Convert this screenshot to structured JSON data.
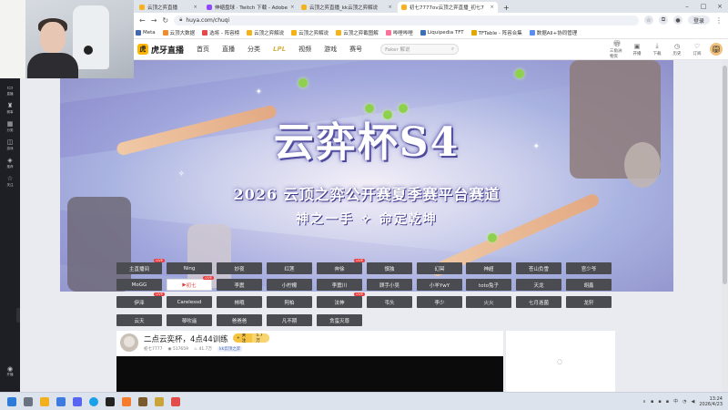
{
  "browser": {
    "tabs": [
      {
        "label": "云顶之弈直播",
        "active": false
      },
      {
        "label": "伸缩盘球 · Twitch 下载 - Adobe",
        "active": false
      },
      {
        "label": "云顶之弈直播_kk云顶之弈解说",
        "active": false
      },
      {
        "label": "初七7777ov云顶之弈直播_初七7",
        "active": true
      }
    ],
    "new_tab": "+",
    "url": "huya.com/chuqi",
    "login_label": "登录",
    "bookmarks": [
      {
        "label": "Meta",
        "color": "#4267b2"
      },
      {
        "label": "云顶大数据",
        "color": "#f28c28"
      },
      {
        "label": "选将 - 阵容榜",
        "color": "#e34a4a"
      },
      {
        "label": "云顶之弈解说",
        "color": "#f6b21b"
      },
      {
        "label": "云顶之弈解说",
        "color": "#f6b21b"
      },
      {
        "label": "云顶之弈截图解",
        "color": "#f6b21b"
      },
      {
        "label": "哔哩哔哩",
        "color": "#fb7299"
      },
      {
        "label": "Liquipedia TFT",
        "color": "#3b6fb6"
      },
      {
        "label": "TFTable - 阵容合集",
        "color": "#e0a800"
      },
      {
        "label": "数据All+协同管理",
        "color": "#5a8dee"
      }
    ]
  },
  "huya": {
    "logo_text": "虎牙直播",
    "nav": [
      "首页",
      "直播",
      "分类",
      "LPL",
      "视频",
      "游戏",
      "赛号"
    ],
    "search_placeholder": "Faker 解说",
    "right_items": [
      {
        "label": "三角洲物资",
        "icon": "gift-icon"
      },
      {
        "label": "开播",
        "icon": "camera-icon"
      },
      {
        "label": "下载",
        "icon": "download-icon"
      },
      {
        "label": "历史",
        "icon": "clock-icon"
      },
      {
        "label": "订阅",
        "icon": "heart-icon"
      }
    ]
  },
  "sidebar": {
    "items": [
      {
        "label": "直播",
        "icon": "tv-icon"
      },
      {
        "label": "赛事",
        "icon": "trophy-icon"
      },
      {
        "label": "分类",
        "icon": "grid-icon"
      },
      {
        "label": "游戏",
        "icon": "gamepad-icon"
      },
      {
        "label": "推荐",
        "icon": "compass-icon"
      },
      {
        "label": "关注",
        "icon": "star-icon"
      }
    ],
    "bottom_label": "开播"
  },
  "banner": {
    "title": "云弈杯S4",
    "subtitle": "2026 云顶之弈公开赛夏季赛平台赛道",
    "slogan": "神之一手 ✧ 命定乾坤"
  },
  "streamers": [
    {
      "name": "主直播间",
      "live": true,
      "selected": false
    },
    {
      "name": "Ning",
      "live": false,
      "selected": false
    },
    {
      "name": "妙夜",
      "live": false,
      "selected": false
    },
    {
      "name": "红莲",
      "live": false,
      "selected": false
    },
    {
      "name": "奔徐",
      "live": true,
      "selected": false
    },
    {
      "name": "慎独",
      "live": false,
      "selected": false
    },
    {
      "name": "幻冥",
      "live": false,
      "selected": false
    },
    {
      "name": "神超",
      "live": false,
      "selected": false
    },
    {
      "name": "苍山负雪",
      "live": false,
      "selected": false
    },
    {
      "name": "官少爷",
      "live": false,
      "selected": false
    },
    {
      "name": "MoGG",
      "live": false,
      "selected": false
    },
    {
      "name": "初七",
      "live": true,
      "selected": true
    },
    {
      "name": "李震",
      "live": false,
      "selected": false
    },
    {
      "name": "小柠檬",
      "live": false,
      "selected": false
    },
    {
      "name": "李震川",
      "live": false,
      "selected": false
    },
    {
      "name": "顾手小吴",
      "live": false,
      "selected": false
    },
    {
      "name": "小羊YwY",
      "live": false,
      "selected": false
    },
    {
      "name": "toto兔子",
      "live": false,
      "selected": false
    },
    {
      "name": "天龙",
      "live": false,
      "selected": false
    },
    {
      "name": "胡鑫",
      "live": false,
      "selected": false
    },
    {
      "name": "伊泽",
      "live": true,
      "selected": false
    },
    {
      "name": "Carelessd",
      "live": false,
      "selected": false
    },
    {
      "name": "林哦",
      "live": false,
      "selected": false
    },
    {
      "name": "阿柏",
      "live": false,
      "selected": false
    },
    {
      "name": "法神",
      "live": true,
      "selected": false
    },
    {
      "name": "弔头",
      "live": false,
      "selected": false
    },
    {
      "name": "李少",
      "live": false,
      "selected": false
    },
    {
      "name": "火火",
      "live": false,
      "selected": false
    },
    {
      "name": "七月逝菌",
      "live": false,
      "selected": false
    },
    {
      "name": "龙轩",
      "live": false,
      "selected": false
    },
    {
      "name": "云天",
      "live": false,
      "selected": false
    },
    {
      "name": "琴吹遥",
      "live": false,
      "selected": false
    },
    {
      "name": "爸爸爸",
      "live": false,
      "selected": false
    },
    {
      "name": "凡不期",
      "live": false,
      "selected": false
    },
    {
      "name": "贪蛮灭尊",
      "live": false,
      "selected": false
    }
  ],
  "live_badge": "LIVE",
  "stream": {
    "title": "二点云奕杯，4点44训练",
    "follow_label": "关注",
    "follow_count": "5.7万",
    "streamer_name": "初七7777",
    "viewers": "517659",
    "heat": "41.7万",
    "category_badge": "kk云顶之弈"
  },
  "taskbar": {
    "time": "13:24",
    "date": "2026/4/23",
    "lang": "中"
  }
}
